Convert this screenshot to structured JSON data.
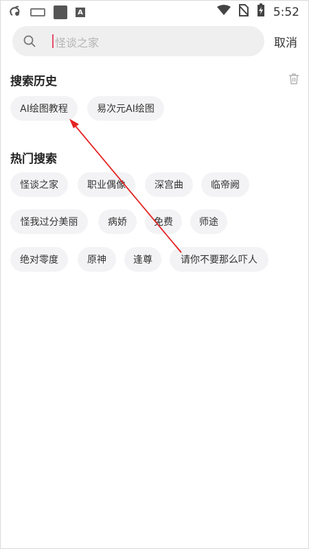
{
  "status_bar": {
    "time": "5:52",
    "left_icons": [
      "uc-browser-icon",
      "keyboard-icon",
      "app-square-icon",
      "ab-icon"
    ],
    "right_icons": [
      "wifi-icon",
      "no-sim-icon",
      "battery-charging-icon"
    ]
  },
  "search": {
    "placeholder": "怪谈之家",
    "cancel_label": "取消"
  },
  "history": {
    "title": "搜索历史",
    "items": [
      "AI绘图教程",
      "易次元AI绘图"
    ]
  },
  "hot": {
    "title": "热门搜索",
    "items": [
      "怪谈之家",
      "职业偶像",
      "深宫曲",
      "临帝阙",
      "怪我过分美丽",
      "病娇",
      "免费",
      "师途",
      "绝对零度",
      "原神",
      "逢尊",
      "请你不要那么吓人"
    ]
  },
  "colors": {
    "chip_bg": "#f3f3f5",
    "search_bg": "#efefef",
    "caret": "#e94b6a",
    "arrow": "#e52222"
  }
}
